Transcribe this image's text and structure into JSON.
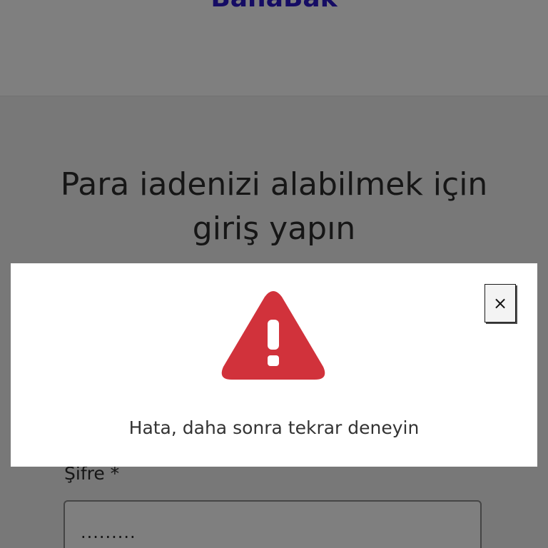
{
  "header": {
    "logo_text": "BanaBak",
    "logo_color": "#2a18c9"
  },
  "main": {
    "title": "Para iadenizi alabilmek için giriş yapın",
    "password_label": "Şifre *",
    "password_value": "........."
  },
  "modal": {
    "icon": "warning-triangle-icon",
    "icon_color": "#d1323b",
    "close_label": "×",
    "message": "Hata, daha sonra tekrar deneyin"
  }
}
